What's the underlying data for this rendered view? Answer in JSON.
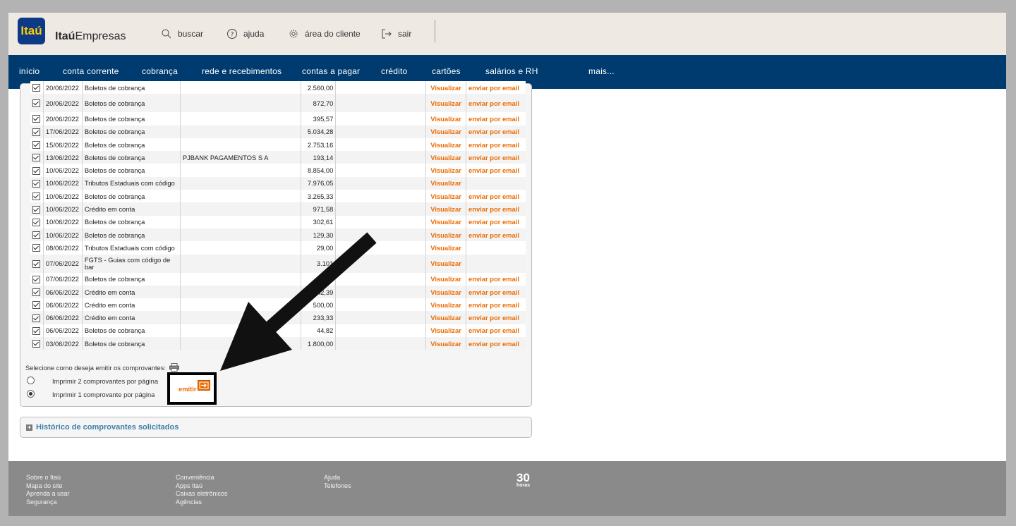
{
  "header": {
    "logo_text": "Itaú",
    "brand_bold": "Itaú",
    "brand_rest": "Empresas",
    "links": [
      {
        "icon": "search-icon",
        "label": "buscar"
      },
      {
        "icon": "help-icon",
        "label": "ajuda"
      },
      {
        "icon": "gear-icon",
        "label": "área do cliente"
      },
      {
        "icon": "logout-icon",
        "label": "sair"
      }
    ]
  },
  "nav": {
    "items": [
      "início",
      "conta corrente",
      "cobrança",
      "rede e recebimentos",
      "contas a pagar",
      "crédito",
      "cartões",
      "salários e RH",
      "mais..."
    ]
  },
  "table": {
    "rows": [
      {
        "date": "20/06/2022",
        "desc": "Boletos de cobrança",
        "fav": "",
        "value": "2.560,00",
        "vis": "Visualizar",
        "mail": "enviar por email"
      },
      {
        "date": "20/06/2022",
        "desc": "Boletos de cobrança",
        "fav": "",
        "value": "872,70",
        "vis": "Visualizar",
        "mail": "enviar por email"
      },
      {
        "date": "20/06/2022",
        "desc": "Boletos de cobrança",
        "fav": "",
        "value": "395,57",
        "vis": "Visualizar",
        "mail": "enviar por email"
      },
      {
        "date": "17/06/2022",
        "desc": "Boletos de cobrança",
        "fav": "",
        "value": "5.034,28",
        "vis": "Visualizar",
        "mail": "enviar por email"
      },
      {
        "date": "15/06/2022",
        "desc": "Boletos de cobrança",
        "fav": "",
        "value": "2.753,16",
        "vis": "Visualizar",
        "mail": "enviar por email"
      },
      {
        "date": "13/06/2022",
        "desc": "Boletos de cobrança",
        "fav": "PJBANK PAGAMENTOS S A",
        "value": "193,14",
        "vis": "Visualizar",
        "mail": "enviar por email"
      },
      {
        "date": "10/06/2022",
        "desc": "Boletos de cobrança",
        "fav": "",
        "value": "8.854,00",
        "vis": "Visualizar",
        "mail": "enviar por email"
      },
      {
        "date": "10/06/2022",
        "desc": "Tributos Estaduais com código",
        "fav": "",
        "value": "7.976,05",
        "vis": "Visualizar",
        "mail": ""
      },
      {
        "date": "10/06/2022",
        "desc": "Boletos de cobrança",
        "fav": "",
        "value": "3.265,33",
        "vis": "Visualizar",
        "mail": "enviar por email"
      },
      {
        "date": "10/06/2022",
        "desc": "Crédito em conta",
        "fav": "",
        "value": "971,58",
        "vis": "Visualizar",
        "mail": "enviar por email"
      },
      {
        "date": "10/06/2022",
        "desc": "Boletos de cobrança",
        "fav": "",
        "value": "302,61",
        "vis": "Visualizar",
        "mail": "enviar por email"
      },
      {
        "date": "10/06/2022",
        "desc": "Boletos de cobrança",
        "fav": "",
        "value": "129,30",
        "vis": "Visualizar",
        "mail": "enviar por email"
      },
      {
        "date": "08/06/2022",
        "desc": "Tributos Estaduais com código",
        "fav": "",
        "value": "29,00",
        "vis": "Visualizar",
        "mail": ""
      },
      {
        "date": "07/06/2022",
        "desc": "FGTS - Guias com código de bar",
        "fav": "",
        "value": "3.101",
        "vis": "Visualizar",
        "mail": ""
      },
      {
        "date": "07/06/2022",
        "desc": "Boletos de cobrança",
        "fav": "",
        "value": ",00",
        "vis": "Visualizar",
        "mail": "enviar por email"
      },
      {
        "date": "06/06/2022",
        "desc": "Crédito em conta",
        "fav": "",
        "value": "142,39",
        "vis": "Visualizar",
        "mail": "enviar por email"
      },
      {
        "date": "06/06/2022",
        "desc": "Crédito em conta",
        "fav": "",
        "value": "500,00",
        "vis": "Visualizar",
        "mail": "enviar por email"
      },
      {
        "date": "06/06/2022",
        "desc": "Crédito em conta",
        "fav": "",
        "value": "233,33",
        "vis": "Visualizar",
        "mail": "enviar por email"
      },
      {
        "date": "06/06/2022",
        "desc": "Boletos de cobrança",
        "fav": "",
        "value": "44,82",
        "vis": "Visualizar",
        "mail": "enviar por email"
      },
      {
        "date": "03/06/2022",
        "desc": "Boletos de cobrança",
        "fav": "",
        "value": "1.800,00",
        "vis": "Visualizar",
        "mail": "enviar por email"
      }
    ]
  },
  "emit": {
    "prompt": "Selecione como deseja emitir os comprovantes:",
    "option1": "Imprimir 2 comprovantes por página",
    "option2": "Imprimir 1 comprovante por página",
    "selected": 2,
    "button": "emitir"
  },
  "history": {
    "label": "Histórico de comprovantes solicitados"
  },
  "footer": {
    "col1": [
      "Sobre o Itaú",
      "Mapa do site",
      "Aprenda a usar",
      "Segurança"
    ],
    "col2": [
      "Conveniência",
      "Apps Itaú",
      "Caixas eletrônicos",
      "Agências"
    ],
    "col3": [
      "Ajuda",
      "Telefones"
    ],
    "badge_number": "30",
    "badge_text": "horas"
  },
  "colors": {
    "nav": "#003b6f",
    "accent": "#ec6b00",
    "header": "#efe9e4",
    "footer": "#8a8a8a"
  }
}
